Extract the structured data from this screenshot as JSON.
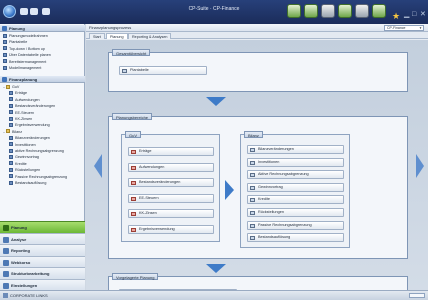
{
  "window": {
    "title": "CP-Suite · CP-Finance"
  },
  "left": {
    "section_planning": "Planung",
    "tree1": [
      {
        "label": "Planungsmodellrahmen",
        "folder": false
      },
      {
        "label": "Plantabelle",
        "folder": false
      },
      {
        "label": "Top-down / Bottom up",
        "folder": false
      },
      {
        "label": "Über Datentabelle planen",
        "folder": false
      },
      {
        "label": "Bereitstermanagement",
        "folder": false
      },
      {
        "label": "Modellmanagement",
        "folder": false
      }
    ],
    "section_process": "Finanzplanung",
    "tree2": [
      {
        "label": "GuV",
        "folder": true,
        "indent": 0,
        "twist": "-"
      },
      {
        "label": "Erträge",
        "folder": false,
        "indent": 2
      },
      {
        "label": "Aufwendungen",
        "folder": false,
        "indent": 2
      },
      {
        "label": "Bestandsveränderungen",
        "folder": false,
        "indent": 2
      },
      {
        "label": "EE-Steuern",
        "folder": false,
        "indent": 2
      },
      {
        "label": "KK-Zinsen",
        "folder": false,
        "indent": 2
      },
      {
        "label": "Ergebnisverwendung",
        "folder": false,
        "indent": 2
      },
      {
        "label": "Bilanz",
        "folder": true,
        "indent": 0,
        "twist": "-"
      },
      {
        "label": "Bilanzveränderungen",
        "folder": false,
        "indent": 2
      },
      {
        "label": "Investitionen",
        "folder": false,
        "indent": 2
      },
      {
        "label": "aktive Rechnungsabgrenzung",
        "folder": false,
        "indent": 2
      },
      {
        "label": "Gewinnvortrag",
        "folder": false,
        "indent": 2
      },
      {
        "label": "Kredite",
        "folder": false,
        "indent": 2
      },
      {
        "label": "Rückstellungen",
        "folder": false,
        "indent": 2
      },
      {
        "label": "Passive Rechnungsabgrenzung",
        "folder": false,
        "indent": 2
      },
      {
        "label": "Bestandsauflösung",
        "folder": false,
        "indent": 2
      }
    ],
    "nav": [
      "Planung",
      "Analyse",
      "Reporting",
      "Webkorso",
      "Strukturbearbeitung",
      "Einstellungen"
    ]
  },
  "main": {
    "header_title": "Finanzplanungsprozess",
    "select_value": "CP-Finance",
    "tabs": [
      "Start",
      "Planung",
      "Reporting & Analysen"
    ],
    "group_overview": {
      "label": "Gesamtübersicht",
      "button": "Plantabelle"
    },
    "group_areas": {
      "label": "Planungsbereiche",
      "guv": {
        "label": "GuV",
        "items": [
          "Erträge",
          "Aufwendungen",
          "Bestandsveränderungen",
          "EE-Steuern",
          "KK-Zinsen",
          "Ergebnisverwendung"
        ]
      },
      "bilanz": {
        "label": "Bilanz",
        "items": [
          "Bilanzveränderungen",
          "Investitionen",
          "Aktive Rechnungsabgrenzung",
          "Gewinnvortrag",
          "Kredite",
          "Rückstellungen",
          "Passive Rechnungsabgrenzung",
          "Bestandsauflösung"
        ]
      }
    },
    "group_upstream": {
      "label": "Vorgelagerte Planung",
      "button": "Aktualisierung operativer Planung"
    }
  },
  "status": {
    "text": "CORPORATE LINKS"
  }
}
